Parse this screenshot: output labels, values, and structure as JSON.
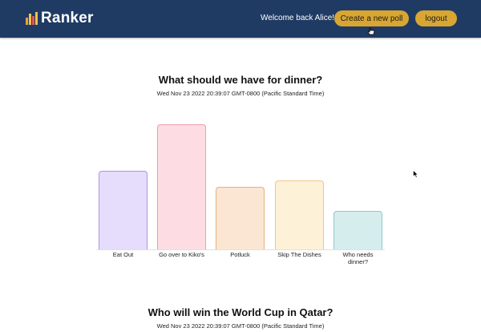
{
  "navbar": {
    "brand": "Ranker",
    "welcome": "Welcome back Alice!",
    "create_label": "Create a new poll",
    "logout_label": "logout",
    "logo_colors": [
      "#e8a23a",
      "#f3c34b",
      "#e2594f",
      "#f3c34b"
    ]
  },
  "polls": [
    {
      "title": "What should we have for dinner?",
      "date": "Wed Nov 23 2022 20:39:07 GMT-0800 (Pacific Standard Time)"
    },
    {
      "title": "Who will win the World Cup in Qatar?",
      "date": "Wed Nov 23 2022 20:39:07 GMT-0800 (Pacific Standard Time)"
    }
  ],
  "chart_data": {
    "type": "bar",
    "categories": [
      "Eat Out",
      "Go over to Kiko's",
      "Potluck",
      "Skip The Dishes",
      "Who needs dinner?"
    ],
    "values": [
      0.63,
      1.0,
      0.5,
      0.55,
      0.31
    ],
    "fill_colors": [
      "#e6dcfb",
      "#fddde3",
      "#fbe6d3",
      "#fdf1d7",
      "#d6edee"
    ],
    "border_colors": [
      "#a898dd",
      "#ef9aab",
      "#e8b07e",
      "#efc886",
      "#8fc8cd"
    ]
  }
}
